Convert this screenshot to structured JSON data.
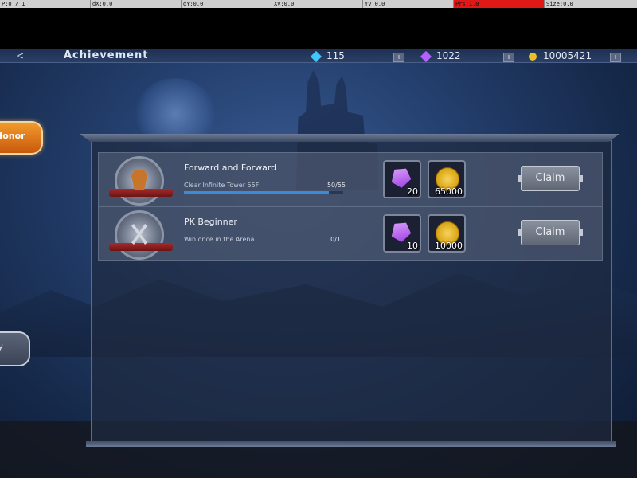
{
  "debug_bar": {
    "cells": [
      "P:0 / 1",
      "dX:0.0",
      "dY:0.0",
      "Xv:0.0",
      "Yv:0.0",
      "Prs:1.0",
      "Size:0.0"
    ]
  },
  "header": {
    "back_label": "<",
    "title": "Achievement",
    "diamonds": "115",
    "gems": "1022",
    "gold": "10005421",
    "plus_label": "+"
  },
  "tabs": {
    "honor": "Honor",
    "activity": "ty"
  },
  "achievements": [
    {
      "title": "Forward and Forward",
      "description": "Clear Infinite Tower 55F",
      "progress_text": "50/55",
      "progress": 0.909,
      "rewards": [
        {
          "icon": "purple-gem-icon",
          "qty": "20"
        },
        {
          "icon": "gold-coin-icon",
          "qty": "65000"
        }
      ],
      "claim_label": "Claim",
      "badge_icon": "tower-badge-icon"
    },
    {
      "title": "PK Beginner",
      "description": "Win once in the Arena.",
      "progress_text": "0/1",
      "progress": 0,
      "rewards": [
        {
          "icon": "purple-gem-icon",
          "qty": "10"
        },
        {
          "icon": "gold-coin-icon",
          "qty": "10000"
        }
      ],
      "claim_label": "Claim",
      "badge_icon": "swords-badge-icon"
    }
  ],
  "colors": {
    "progress_fill": "#3f8ad6",
    "honor_tab": "#f29b2c",
    "debug_hot": "#e01818"
  }
}
